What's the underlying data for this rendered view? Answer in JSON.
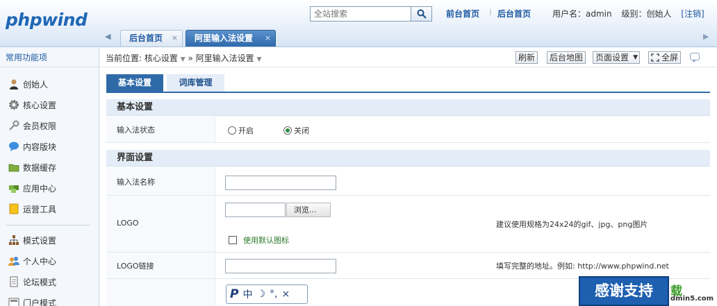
{
  "header": {
    "logo": "phpwind",
    "search_placeholder": "全站搜索",
    "front_home": "前台首页",
    "admin_home": "后台首页",
    "user_label": "用户名：admin",
    "level_label": "级别：创始人",
    "logout": "[注销]"
  },
  "tabs": [
    {
      "label": "后台首页",
      "close": "×"
    },
    {
      "label": "阿里输入法设置",
      "close": "×"
    }
  ],
  "sidebar": {
    "title": "常用功能项",
    "items": [
      {
        "label": "创始人",
        "icon": "person-icon"
      },
      {
        "label": "核心设置",
        "icon": "gear-icon"
      },
      {
        "label": "会员权限",
        "icon": "key-icon"
      },
      {
        "label": "内容版块",
        "icon": "speech-bubble-icon"
      },
      {
        "label": "数据缓存",
        "icon": "folder-icon"
      },
      {
        "label": "应用中心",
        "icon": "puzzle-icon"
      },
      {
        "label": "运营工具",
        "icon": "note-icon"
      },
      {
        "label": "模式设置",
        "icon": "sitemap-icon"
      },
      {
        "label": "个人中心",
        "icon": "users-icon"
      },
      {
        "label": "论坛模式",
        "icon": "document-icon"
      },
      {
        "label": "门户模式",
        "icon": "portal-icon"
      }
    ]
  },
  "breadcrumb": {
    "prefix": "当前位置:",
    "level1": "核心设置",
    "sep": "»",
    "level2": "阿里输入法设置"
  },
  "toolbar": {
    "refresh": "刷新",
    "sitemap": "后台地图",
    "page_settings": "页面设置",
    "fullscreen": "全屏"
  },
  "subtabs": [
    "基本设置",
    "词库管理"
  ],
  "section_basic": {
    "title": "基本设置",
    "status_label": "输入法状态",
    "option_on": "开启",
    "option_off": "关闭",
    "selected": "关闭"
  },
  "section_ui": {
    "title": "界面设置",
    "name_label": "输入法名称",
    "name_value": "",
    "logo_label": "LOGO",
    "browse_label": "浏览...",
    "use_default_icon": "使用默认图标",
    "logo_hint": "建议使用规格为24x24的gif、jpg、png图片",
    "logo_link_label": "LOGO链接",
    "logo_link_value": "",
    "logo_link_hint": "填写完整的地址。例如: http://www.phpwind.net"
  },
  "ime_bar": {
    "p": "P",
    "zh": "中",
    "moon": "☽",
    "punct": "°,",
    "close": "×"
  },
  "overlay": {
    "banner": "感谢支持",
    "watermark": "载",
    "watermark_sub": "dmin5.com"
  }
}
